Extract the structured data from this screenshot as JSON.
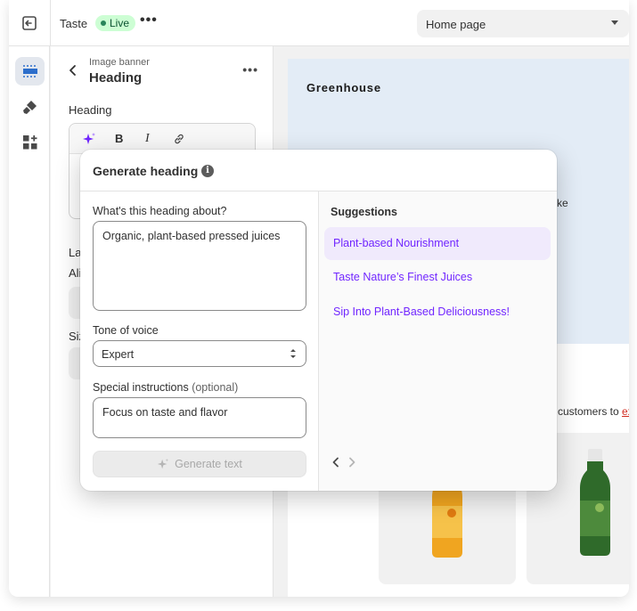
{
  "topbar": {
    "theme_name": "Taste",
    "status_badge": "Live",
    "page_selector": "Home page"
  },
  "panel": {
    "breadcrumb": "Image banner",
    "title": "Heading",
    "heading_field_label": "Heading",
    "toolbar": {
      "bold": "B",
      "italic": "I"
    },
    "partial_labels": {
      "layout": "La",
      "alignment": "Ali",
      "size": "Siz"
    }
  },
  "preview": {
    "brand": "Greenhouse",
    "hero_fragment": "ke",
    "customers_text": "customers to ",
    "customers_link": "ex"
  },
  "modal": {
    "title": "Generate heading",
    "about_label": "What's this heading about?",
    "about_value": "Organic, plant-based pressed juices",
    "tone_label": "Tone of voice",
    "tone_value": "Expert",
    "special_label": "Special instructions",
    "special_optional": "(optional)",
    "special_value": "Focus on taste and flavor",
    "generate_button": "Generate text",
    "suggestions_title": "Suggestions",
    "suggestions": [
      {
        "text": "Plant-based Nourishment",
        "selected": true
      },
      {
        "text": "Taste Nature’s Finest Juices",
        "selected": false
      },
      {
        "text": "Sip Into Plant-Based Deliciousness!",
        "selected": false
      }
    ]
  },
  "colors": {
    "accent_purple": "#7126ff",
    "live_badge_bg": "#cdfed4",
    "hero_bg": "#e3ecf6"
  }
}
